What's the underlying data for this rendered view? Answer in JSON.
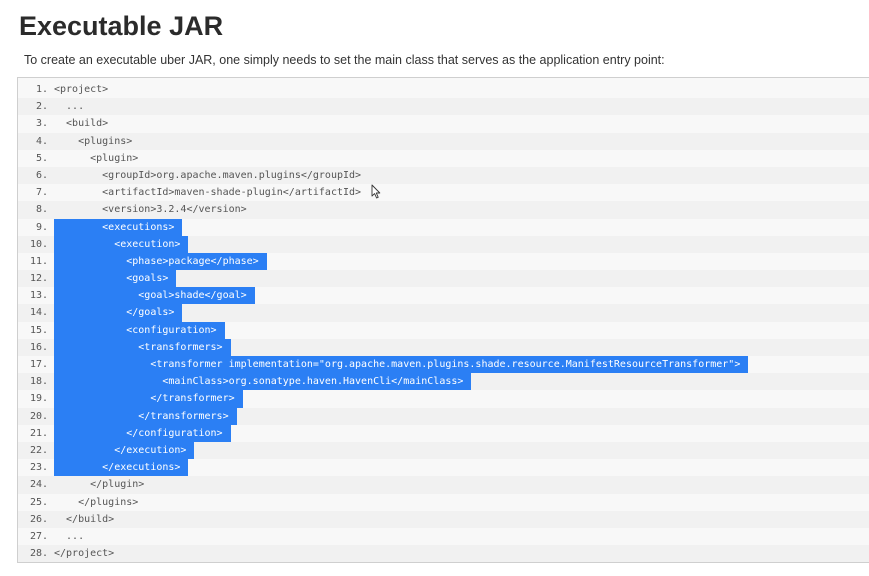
{
  "heading": "Executable JAR",
  "intro": "To create an executable uber JAR, one simply needs to set the main class that serves as the application entry point:",
  "selection_color": "#2b7ff4",
  "code_lines": [
    {
      "n": "1.",
      "text": "<project>"
    },
    {
      "n": "2.",
      "text": "  ..."
    },
    {
      "n": "3.",
      "text": "  <build>"
    },
    {
      "n": "4.",
      "text": "    <plugins>"
    },
    {
      "n": "5.",
      "text": "      <plugin>"
    },
    {
      "n": "6.",
      "text": "        <groupId>org.apache.maven.plugins</groupId>"
    },
    {
      "n": "7.",
      "text": "        <artifactId>maven-shade-plugin</artifactId>"
    },
    {
      "n": "8.",
      "text": "        <version>3.2.4</version>"
    },
    {
      "n": "9.",
      "text": "        <executions>",
      "selected": true
    },
    {
      "n": "10.",
      "text": "          <execution>",
      "selected": true
    },
    {
      "n": "11.",
      "text": "            <phase>package</phase>",
      "selected": true
    },
    {
      "n": "12.",
      "text": "            <goals>",
      "selected": true
    },
    {
      "n": "13.",
      "text": "              <goal>shade</goal>",
      "selected": true
    },
    {
      "n": "14.",
      "text": "            </goals>",
      "selected": true
    },
    {
      "n": "15.",
      "text": "            <configuration>",
      "selected": true
    },
    {
      "n": "16.",
      "text": "              <transformers>",
      "selected": true
    },
    {
      "n": "17.",
      "text": "                <transformer implementation=\"org.apache.maven.plugins.shade.resource.ManifestResourceTransformer\">",
      "selected": true
    },
    {
      "n": "18.",
      "text": "                  <mainClass>org.sonatype.haven.HavenCli</mainClass>",
      "selected": true
    },
    {
      "n": "19.",
      "text": "                </transformer>",
      "selected": true
    },
    {
      "n": "20.",
      "text": "              </transformers>",
      "selected": true
    },
    {
      "n": "21.",
      "text": "            </configuration>",
      "selected": true
    },
    {
      "n": "22.",
      "text": "          </execution>",
      "selected": true
    },
    {
      "n": "23.",
      "text": "        </executions>",
      "selected": true
    },
    {
      "n": "24.",
      "text": "      </plugin>"
    },
    {
      "n": "25.",
      "text": "    </plugins>"
    },
    {
      "n": "26.",
      "text": "  </build>"
    },
    {
      "n": "27.",
      "text": "  ..."
    },
    {
      "n": "28.",
      "text": "</project>"
    }
  ]
}
